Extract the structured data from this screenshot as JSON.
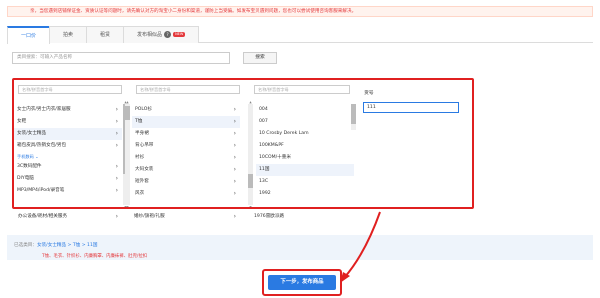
{
  "notice": {
    "text": "亲，当您遇到店铺保证金、资质认证等问题时，请先确认对方的淘宝小二身份和渠道，谨防上当受骗。如发布宝贝遇到问题，您也可以尝试使用咨询客服来解决。"
  },
  "tabs": [
    {
      "label": "一口价"
    },
    {
      "label": "拍卖"
    },
    {
      "label": "租赁"
    },
    {
      "label": "发布相似品",
      "help": "?",
      "badge": "NEW"
    }
  ],
  "search": {
    "placeholder": "类目搜索：可输入产品名称",
    "button": "搜索"
  },
  "columns": {
    "col1": {
      "search_placeholder": "名称/拼音首字母",
      "items": [
        {
          "label": "女士内衣/男士内衣/家居服",
          "has_children": true
        },
        {
          "label": "女鞋",
          "has_children": true
        },
        {
          "label": "女装/女士精品",
          "has_children": true,
          "selected": true
        },
        {
          "label": "箱包皮具/热销女包/男包",
          "has_children": true
        },
        {
          "label": "手机数码",
          "group": true
        },
        {
          "label": "3C数码配件",
          "has_children": true
        },
        {
          "label": "DIY电脑",
          "has_children": true
        },
        {
          "label": "MP3/MP4/iPod/录音笔",
          "has_children": true
        }
      ],
      "overflow_item": "办公设备/耗材/相关服务"
    },
    "col2": {
      "search_placeholder": "名称/拼音首字母",
      "items": [
        {
          "label": "POLO衫",
          "has_children": true
        },
        {
          "label": "T恤",
          "has_children": true,
          "selected": true
        },
        {
          "label": "半身裙",
          "has_children": true
        },
        {
          "label": "背心吊带",
          "has_children": true
        },
        {
          "label": "衬衫",
          "has_children": true
        },
        {
          "label": "大码女装",
          "has_children": true
        },
        {
          "label": "短外套",
          "has_children": true
        },
        {
          "label": "风衣",
          "has_children": true
        }
      ],
      "overflow_item": "婚纱/旗袍/礼服"
    },
    "col3": {
      "search_placeholder": "名称/拼音首字母",
      "items": [
        {
          "label": "004"
        },
        {
          "label": "007"
        },
        {
          "label": "10 Crosby Derek Lam"
        },
        {
          "label": "100KM&PF"
        },
        {
          "label": "10COM/十重米"
        },
        {
          "label": "11国",
          "selected": true
        },
        {
          "label": "13C"
        },
        {
          "label": "1992"
        }
      ],
      "overflow_item": "1976雷欧派路"
    }
  },
  "brand": {
    "label": "货号",
    "value": "111"
  },
  "selected": {
    "prefix": "已选类目：",
    "path": "女装/女士精品 > T恤 > 11国"
  },
  "tip": {
    "text": "T恤、毛衣、针织衫、内廉胸罩、内廉袜裤、肚兜/拉扣"
  },
  "next_button": {
    "label": "下一步，发布商品"
  },
  "colors": {
    "accent": "#2a7ae2",
    "highlight_red": "#e02020",
    "notice_red": "#e4393c"
  }
}
